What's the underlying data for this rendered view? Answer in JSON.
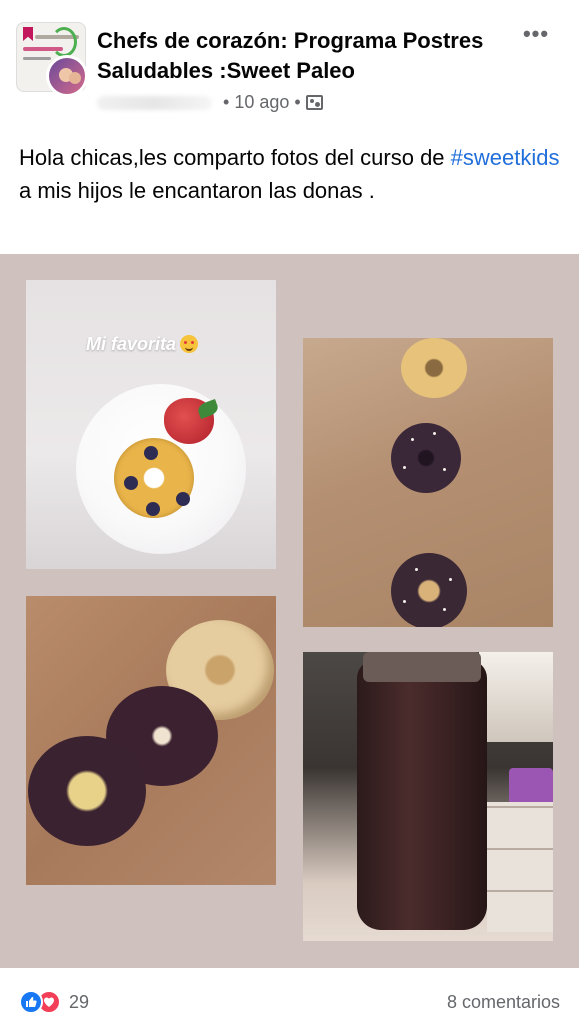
{
  "post": {
    "group_name": "Chefs de corazón: Programa Postres Saludables :Sweet Paleo",
    "time_ago": "10 ago",
    "separator": "•",
    "privacy_icon": "group-icon",
    "more_label": "•••",
    "text_before": "Hola chicas,les comparto fotos del curso de ",
    "hashtag": "#sweetkids",
    "text_after": " a mis hijos le encantaron las donas ."
  },
  "photos": {
    "photo1_caption": "Mi favorita"
  },
  "footer": {
    "reaction_icons": [
      "like-icon",
      "love-icon"
    ],
    "reaction_count": "29",
    "comments_label": "8 comentarios"
  },
  "colors": {
    "hashtag": "#216fdb",
    "photo_background": "#cfc1bd",
    "like": "#1877f2",
    "love": "#f33e58"
  }
}
